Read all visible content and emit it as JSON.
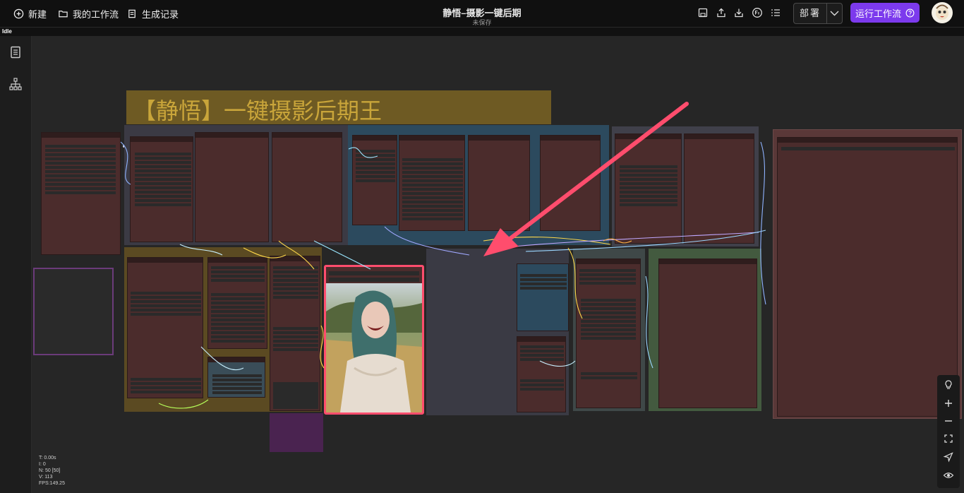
{
  "app": {
    "title": "静悟–摄影一键后期",
    "save_status": "未保存",
    "status": "Idle"
  },
  "toolbar": {
    "new_label": "新建",
    "workflows_label": "我的工作流",
    "history_label": "生成记录",
    "icons": [
      "save-icon",
      "export-icon",
      "download-icon",
      "language-icon",
      "list-icon"
    ],
    "deploy_label": "部署",
    "run_label": "运行工作流"
  },
  "canvas": {
    "banner_title": "【静悟】一键摄影后期王",
    "groups": [
      {
        "name": "group-top-left",
        "label": "",
        "color": "#3b3a44"
      },
      {
        "name": "group-top-middle",
        "label": "",
        "color": "#2c4a5e"
      },
      {
        "name": "group-top-right",
        "label": "",
        "color": "#40404a"
      },
      {
        "name": "group-params",
        "label": "",
        "color": "#5b4a22"
      },
      {
        "name": "group-style",
        "label": "",
        "color": "#3a3a44"
      },
      {
        "name": "group-compare",
        "label": "",
        "color": "#435a3f"
      },
      {
        "name": "group-final",
        "label": "",
        "color": "#5a3838"
      }
    ],
    "annotation": "red-arrow",
    "highlight_color": "#ff4d6d",
    "stats": [
      "T: 0.00s",
      "I: 0",
      "N: 50 [50]",
      "V: 113",
      "FPS:149.25"
    ]
  },
  "sidebar": {
    "icons": [
      "document-icon",
      "node-tree-icon"
    ]
  },
  "right_tools": {
    "icons": [
      "bulb-icon",
      "zoom-in-icon",
      "zoom-out-icon",
      "fit-view-icon",
      "pointer-icon",
      "eye-icon"
    ]
  }
}
